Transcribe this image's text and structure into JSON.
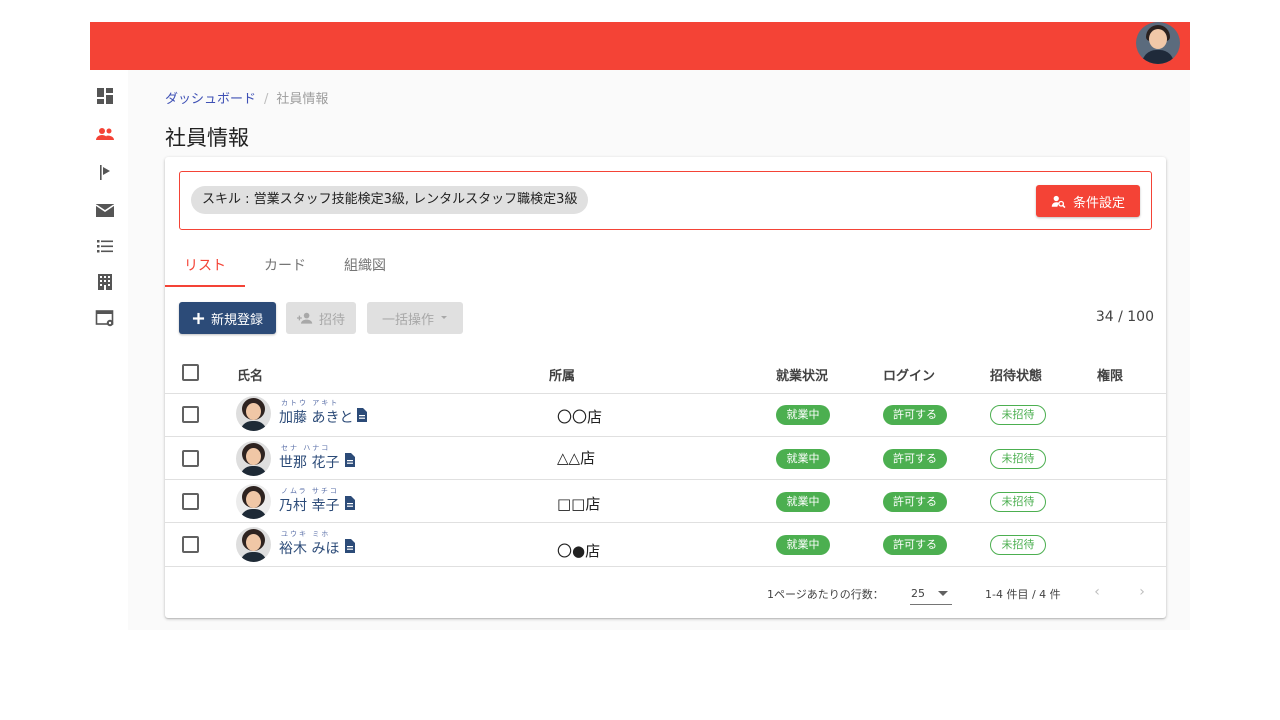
{
  "breadcrumb": {
    "home": "ダッシュボード",
    "separator": "/",
    "current": "社員情報"
  },
  "page_title": "社員情報",
  "filter": {
    "chip": "スキル : 営業スタッフ技能検定3級, レンタルスタッフ職検定3級",
    "button": "条件設定"
  },
  "tabs": [
    {
      "label": "リスト",
      "active": true
    },
    {
      "label": "カード"
    },
    {
      "label": "組織図"
    }
  ],
  "toolbar": {
    "new_label": "新規登録",
    "invite_label": "招待",
    "bulk_label": "一括操作",
    "count": "34 / 100"
  },
  "table": {
    "headers": {
      "name": "氏名",
      "dept": "所属",
      "work": "就業状況",
      "login": "ログイン",
      "invite": "招待状態",
      "perm": "権限"
    },
    "rows": [
      {
        "ruby": "カトウ アキト",
        "name": "加藤 あきと",
        "dept": "〇〇店",
        "work": "就業中",
        "login": "許可する",
        "invite": "未招待"
      },
      {
        "ruby": "セナ ハナコ",
        "name": "世那 花子",
        "dept": "△△店",
        "work": "就業中",
        "login": "許可する",
        "invite": "未招待"
      },
      {
        "ruby": "ノムラ サチコ",
        "name": "乃村 幸子",
        "dept": "□□店",
        "work": "就業中",
        "login": "許可する",
        "invite": "未招待"
      },
      {
        "ruby": "ユウキ ミホ",
        "name": "裕木 みほ",
        "dept": "〇●店",
        "work": "就業中",
        "login": "許可する",
        "invite": "未招待"
      }
    ]
  },
  "pager": {
    "rows_label": "1ページあたりの行数：",
    "rows_value": "25",
    "range": "1-4 件目 / 4 件"
  },
  "colors": {
    "accent": "#f44336",
    "primary": "#2c4b78",
    "success": "#4caf50"
  },
  "icons": [
    "dashboard-icon",
    "people-icon",
    "flag-icon",
    "mail-icon",
    "list-icon",
    "building-icon",
    "window-settings-icon",
    "plus-icon",
    "person-add-icon",
    "person-search-icon",
    "document-icon",
    "chevron-left-icon",
    "chevron-right-icon"
  ]
}
